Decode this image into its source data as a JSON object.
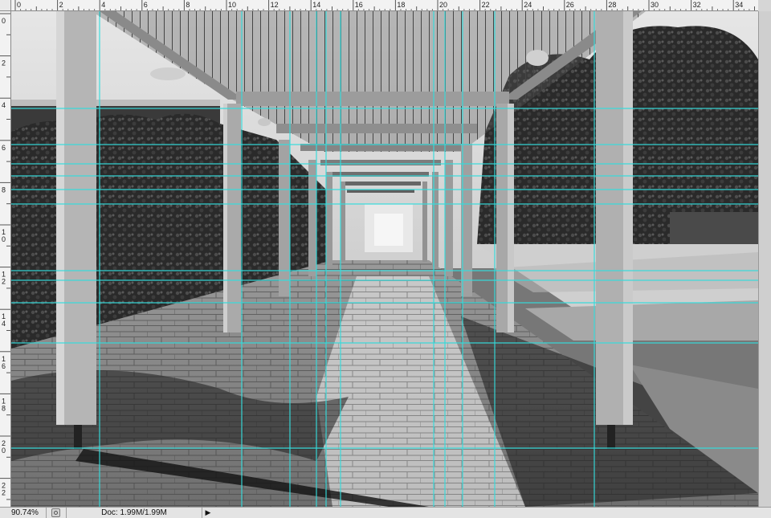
{
  "status_bar": {
    "zoom": "90.74%",
    "doc_info": "Doc: 1.99M/1.99M",
    "status_icon": "document-status-icon",
    "menu_arrow": "▶"
  },
  "rulers": {
    "top_labels": [
      "0",
      "2",
      "4",
      "6",
      "8",
      "10",
      "12",
      "14",
      "16",
      "18",
      "20",
      "22",
      "24",
      "26",
      "28",
      "30",
      "32",
      "34"
    ],
    "left_labels": [
      "0",
      "2",
      "4",
      "6",
      "8",
      "10",
      "12",
      "14",
      "16",
      "18",
      "20",
      "22"
    ]
  },
  "guides_color": "#34dcdc",
  "image": {
    "subject": "black-and-white-covered-walkway-photo"
  }
}
